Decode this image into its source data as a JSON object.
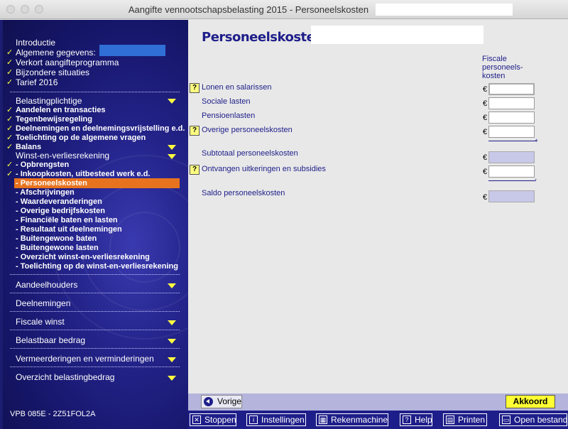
{
  "window": {
    "title": "Aangifte vennootschapsbelasting 2015 - Personeelskosten"
  },
  "sidebar": {
    "intro": [
      {
        "label": "Introductie",
        "checked": false
      },
      {
        "label": "Algemene gegevens:",
        "checked": true
      },
      {
        "label": "Verkort aangifteprogramma",
        "checked": true
      },
      {
        "label": "Bijzondere situaties",
        "checked": true
      },
      {
        "label": "Tarief 2016",
        "checked": true
      }
    ],
    "sections": [
      {
        "label": "Belastingplichtige",
        "checked": false,
        "bold": false
      },
      {
        "label": "Aandelen en transacties",
        "checked": true,
        "bold": true
      },
      {
        "label": "Tegenbewijsregeling",
        "checked": true,
        "bold": true
      },
      {
        "label": "Deelnemingen en deelnemingsvrijstelling e.d.",
        "checked": true,
        "bold": true
      },
      {
        "label": "Toelichting op de algemene vragen",
        "checked": true,
        "bold": true
      },
      {
        "label": "Balans",
        "checked": true,
        "bold": true
      },
      {
        "label": "Winst-en-verliesrekening",
        "checked": false,
        "bold": false
      },
      {
        "label": "- Opbrengsten",
        "checked": true,
        "bold": true
      },
      {
        "label": "- Inkoopkosten, uitbesteed werk e.d.",
        "checked": true,
        "bold": true
      },
      {
        "label": "- Personeelskosten",
        "checked": false,
        "bold": true
      },
      {
        "label": "- Afschrijvingen",
        "checked": false,
        "bold": true
      },
      {
        "label": "- Waardeveranderingen",
        "checked": false,
        "bold": true
      },
      {
        "label": "- Overige bedrijfskosten",
        "checked": false,
        "bold": true
      },
      {
        "label": "- Financiële baten en lasten",
        "checked": false,
        "bold": true
      },
      {
        "label": "- Resultaat uit deelnemingen",
        "checked": false,
        "bold": true
      },
      {
        "label": "- Buitengewone baten",
        "checked": false,
        "bold": true
      },
      {
        "label": "- Buitengewone lasten",
        "checked": false,
        "bold": true
      },
      {
        "label": "- Overzicht winst-en-verliesrekening",
        "checked": false,
        "bold": true
      },
      {
        "label": "- Toelichting op de winst-en-verliesrekening",
        "checked": false,
        "bold": true
      }
    ],
    "groups": [
      {
        "label": "Aandeelhouders"
      },
      {
        "label": "Deelnemingen"
      },
      {
        "label": "Fiscale winst"
      },
      {
        "label": "Belastbaar bedrag"
      },
      {
        "label": "Vermeerderingen en verminderingen"
      },
      {
        "label": "Overzicht belastingbedrag"
      }
    ],
    "version": "VPB 085E - 2Z51FOL2A"
  },
  "main": {
    "title": "Personeelskosten",
    "column_header": "Fiscale personeels-kosten",
    "currency": "€",
    "fields": [
      {
        "label": "Lonen en salarissen",
        "help": true,
        "value": ""
      },
      {
        "label": "Sociale lasten",
        "help": false,
        "value": ""
      },
      {
        "label": "Pensioenlasten",
        "help": false,
        "value": ""
      },
      {
        "label": "Overige personeelskosten",
        "help": true,
        "value": ""
      },
      {
        "label": "Subtotaal personeelskosten",
        "help": false,
        "value": ""
      },
      {
        "label": "Ontvangen uitkeringen en subsidies",
        "help": true,
        "value": ""
      },
      {
        "label": "Saldo personeelskosten",
        "help": false,
        "value": ""
      }
    ],
    "help_label": "?",
    "plus_sign": "+",
    "minus_sign": "-"
  },
  "bottom": {
    "prev": "Vorige",
    "ok": "Akkoord"
  },
  "toolbar": {
    "stop": "Stoppen",
    "settings": "Instellingen",
    "calculator": "Rekenmachine",
    "help": "Help",
    "print": "Printen",
    "open": "Open bestand"
  },
  "colors": {
    "sidebar_bg": "#23238a",
    "active_item": "#e8731e",
    "accent_yellow": "#ffff40",
    "title_blue": "#1e1e8a"
  }
}
